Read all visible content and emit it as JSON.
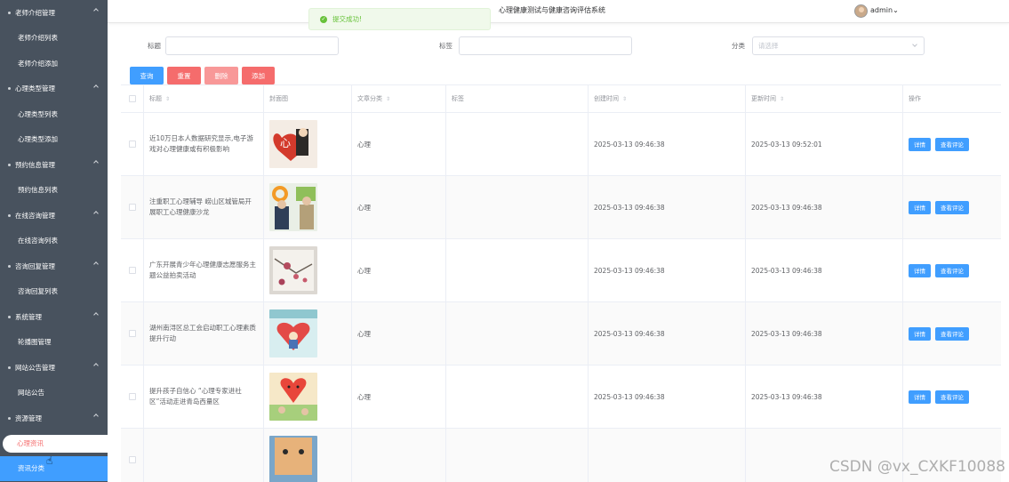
{
  "sidebar": {
    "items": [
      {
        "type": "group",
        "label": "老师介绍管理"
      },
      {
        "type": "sub",
        "label": "老师介绍列表"
      },
      {
        "type": "sub",
        "label": "老师介绍添加"
      },
      {
        "type": "group",
        "label": "心理类型管理"
      },
      {
        "type": "sub",
        "label": "心理类型列表"
      },
      {
        "type": "sub",
        "label": "心理类型添加"
      },
      {
        "type": "group",
        "label": "预约信息管理"
      },
      {
        "type": "sub",
        "label": "预约信息列表"
      },
      {
        "type": "group",
        "label": "在线咨询管理"
      },
      {
        "type": "sub",
        "label": "在线咨询列表"
      },
      {
        "type": "group",
        "label": "咨询回复管理"
      },
      {
        "type": "sub",
        "label": "咨询回复列表"
      },
      {
        "type": "group",
        "label": "系统管理"
      },
      {
        "type": "sub",
        "label": "轮播图管理"
      },
      {
        "type": "group",
        "label": "网站公告管理"
      },
      {
        "type": "sub",
        "label": "网站公告"
      },
      {
        "type": "group",
        "label": "资源管理"
      },
      {
        "type": "sub",
        "label": "心理资讯",
        "state": "current"
      },
      {
        "type": "sub",
        "label": "资讯分类",
        "state": "hovered"
      }
    ]
  },
  "header": {
    "site_title": "心理健康测试与健康咨询评估系统",
    "user_name": "admin",
    "user_caret": "⌄"
  },
  "toast": {
    "message": "提交成功!",
    "color": "#67c23a"
  },
  "search": {
    "title_label": "标题",
    "title_value": "",
    "tag_label": "标签",
    "tag_value": "",
    "category_label": "分类",
    "category_placeholder": "请选择"
  },
  "toolbar": {
    "query_label": "查询",
    "reset_label": "重置",
    "delete_label": "删除",
    "add_label": "添加"
  },
  "table": {
    "columns": [
      "标题",
      "封面图",
      "文章分类",
      "标签",
      "创建时间",
      "更新时间",
      "操作"
    ],
    "detail_label": "详情",
    "comments_label": "查看评论",
    "rows": [
      {
        "title": "近10万日本人数据研究显示,电子游戏对心理健康或有积极影响",
        "category": "心理",
        "tags": "",
        "created": "2025-03-13 09:46:38",
        "updated": "2025-03-13 09:52:01"
      },
      {
        "title": "注重职工心理辅导 崂山区城管局开展职工心理健康沙龙",
        "category": "心理",
        "tags": "",
        "created": "2025-03-13 09:46:38",
        "updated": "2025-03-13 09:46:38"
      },
      {
        "title": "广东开展青少年心理健康志愿服务主题公益拍卖活动",
        "category": "心理",
        "tags": "",
        "created": "2025-03-13 09:46:38",
        "updated": "2025-03-13 09:46:38"
      },
      {
        "title": "湖州南浔区总工会启动职工心理素质提升行动",
        "category": "心理",
        "tags": "",
        "created": "2025-03-13 09:46:38",
        "updated": "2025-03-13 09:46:38"
      },
      {
        "title": "提升孩子自信心 “心理专家进社区”活动走进青岛西量区",
        "category": "心理",
        "tags": "",
        "created": "2025-03-13 09:46:38",
        "updated": "2025-03-13 09:46:38"
      },
      {
        "title": "",
        "category": "",
        "tags": "",
        "created": "",
        "updated": ""
      }
    ]
  },
  "watermark": "CSDN @vx_CXKF10088"
}
